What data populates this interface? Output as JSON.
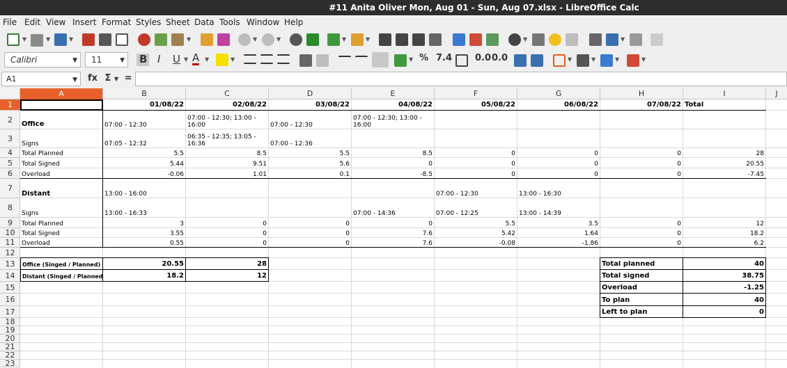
{
  "window": {
    "title": "#11 Anita Oliver Mon, Aug 01 - Sun, Aug 07.xlsx - LibreOffice Calc"
  },
  "menu": [
    "File",
    "Edit",
    "View",
    "Insert",
    "Format",
    "Styles",
    "Sheet",
    "Data",
    "Tools",
    "Window",
    "Help"
  ],
  "toolbar": {
    "font_name": "Calibri",
    "font_size": "11",
    "percent": "%",
    "number_format": "7.4",
    "add_decimal": "0.0",
    "remove_decimal": "0.0"
  },
  "formula_bar": {
    "name_box": "A1",
    "fx": "fx",
    "sigma": "Σ",
    "equals": "="
  },
  "columns": [
    "A",
    "B",
    "C",
    "D",
    "E",
    "F",
    "G",
    "H",
    "I",
    "J"
  ],
  "rows": [
    "1",
    "2",
    "3",
    "4",
    "5",
    "6",
    "7",
    "8",
    "9",
    "10",
    "11",
    "12",
    "13",
    "14",
    "15",
    "16",
    "17",
    "18",
    "19",
    "20",
    "21",
    "22",
    "23"
  ],
  "sheet": {
    "header": [
      "",
      "01/08/22",
      "02/08/22",
      "03/08/22",
      "04/08/22",
      "05/08/22",
      "06/08/22",
      "07/08/22",
      "Total"
    ],
    "office": {
      "label": "Office",
      "times": [
        "07:00 - 12:30",
        "07:00 - 12:30; 13:00 - 16:00",
        "07:00 - 12:30",
        "07:00 - 12:30; 13:00 - 16:00",
        "",
        "",
        "",
        ""
      ],
      "signs_label": "Signs",
      "signs": [
        "07:05 - 12:32",
        "06:35 - 12:35; 13:05 - 16:36",
        "07:00 - 12:36",
        "",
        "",
        "",
        "",
        ""
      ],
      "planned_label": "Total Planned",
      "planned": [
        "5.5",
        "8.5",
        "5.5",
        "8.5",
        "0",
        "0",
        "0",
        "28"
      ],
      "signed_label": "Total Signed",
      "signed": [
        "5.44",
        "9.51",
        "5.6",
        "0",
        "0",
        "0",
        "0",
        "20.55"
      ],
      "overload_label": "Overload",
      "overload": [
        "-0.06",
        "1.01",
        "0.1",
        "-8.5",
        "0",
        "0",
        "0",
        "-7.45"
      ]
    },
    "distant": {
      "label": "Distant",
      "times": [
        "13:00 - 16:00",
        "",
        "",
        "",
        "07:00 - 12:30",
        "13:00 - 16:30",
        "",
        ""
      ],
      "signs_label": "Signs",
      "signs": [
        "13:00 - 16:33",
        "",
        "",
        "07:00 - 14:36",
        "07:00 - 12:25",
        "13:00 - 14:39",
        "",
        ""
      ],
      "planned_label": "Total Planned",
      "planned": [
        "3",
        "0",
        "0",
        "0",
        "5.5",
        "3.5",
        "0",
        "12"
      ],
      "signed_label": "Total Signed",
      "signed": [
        "3.55",
        "0",
        "0",
        "7.6",
        "5.42",
        "1.64",
        "0",
        "18.2"
      ],
      "overload_label": "Overload",
      "overload": [
        "0.55",
        "0",
        "0",
        "7.6",
        "-0.08",
        "-1.86",
        "0",
        "6.2"
      ]
    },
    "summary_left": [
      {
        "label": "Office (Singed / Planned)",
        "signed": "20.55",
        "planned": "28"
      },
      {
        "label": "Distant (Singed / Planned)",
        "signed": "18.2",
        "planned": "12"
      }
    ],
    "summary_right": [
      {
        "label": "Total planned",
        "value": "40"
      },
      {
        "label": "Total signed",
        "value": "38.75"
      },
      {
        "label": "Overload",
        "value": "-1.25"
      },
      {
        "label": "To plan",
        "value": "40"
      },
      {
        "label": "Left to plan",
        "value": "0"
      }
    ]
  }
}
